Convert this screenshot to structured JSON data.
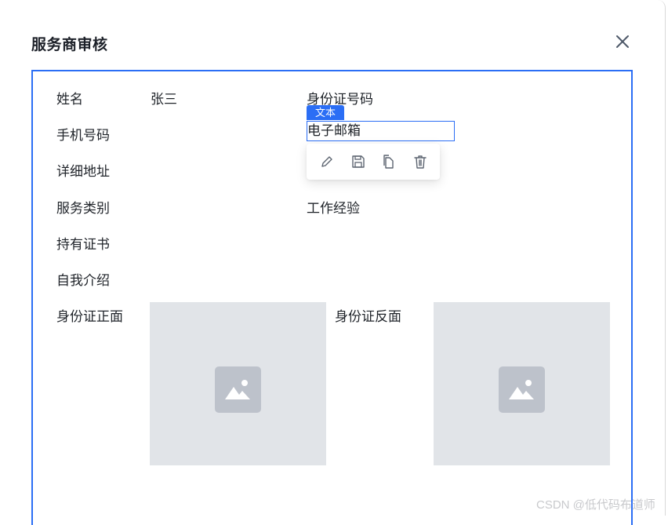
{
  "dialog": {
    "title": "服务商审核",
    "close_icon": "close-icon"
  },
  "form": {
    "name_label": "姓名",
    "name_value": "张三",
    "id_number_label": "身份证号码",
    "phone_label": "手机号码",
    "email_label": "电子邮箱",
    "address_label": "详细地址",
    "service_type_label": "服务类别",
    "work_experience_label": "工作经验",
    "certificate_label": "持有证书",
    "self_intro_label": "自我介绍",
    "id_front_label": "身份证正面",
    "id_back_label": "身份证反面"
  },
  "selection": {
    "type_tag": "文本",
    "toolbar": [
      "edit-icon",
      "save-icon",
      "copy-icon",
      "delete-icon"
    ]
  },
  "colors": {
    "accent": "#2b6ef5",
    "placeholder_bg": "#e1e4e8",
    "placeholder_icon": "#bdc2cb"
  },
  "watermark": "CSDN @低代码布道师"
}
